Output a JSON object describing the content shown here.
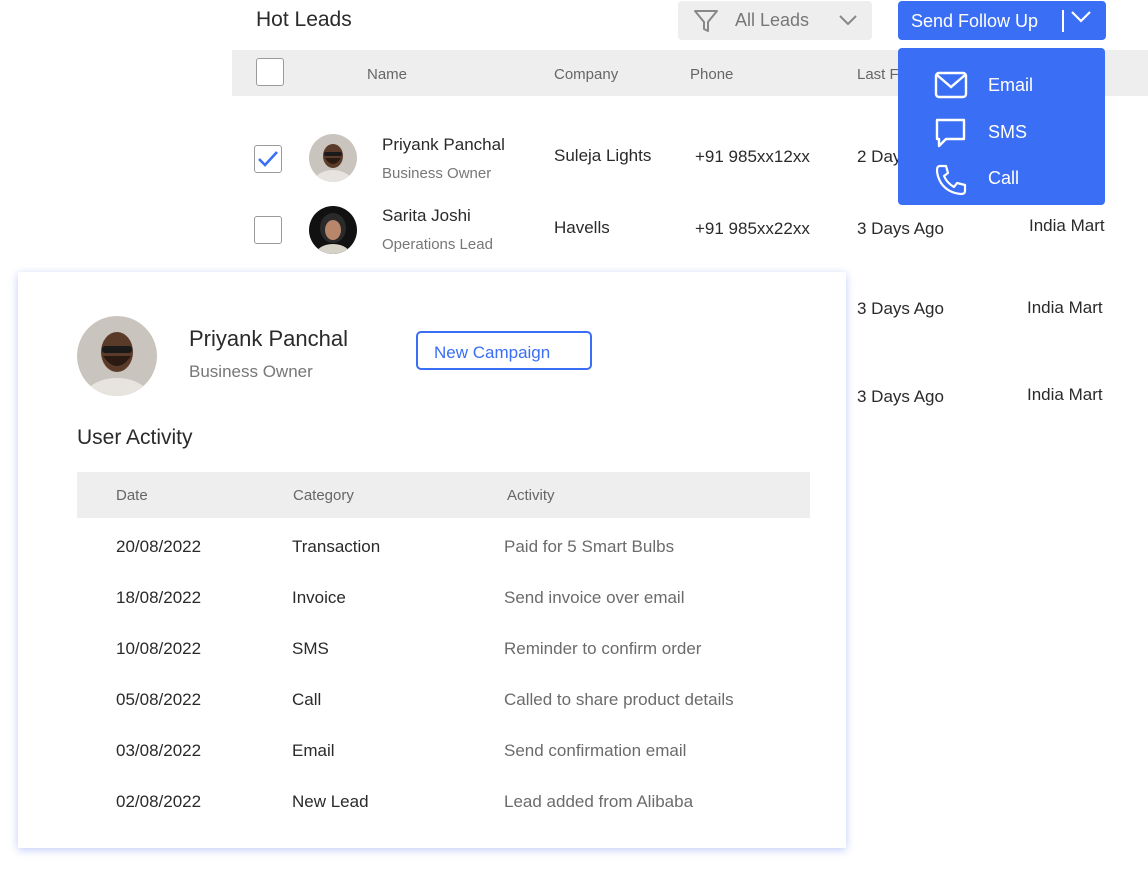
{
  "header": {
    "title": "Hot Leads",
    "filter_label": "All Leads",
    "send_button_label": "Send Follow Up"
  },
  "leads_table": {
    "columns": [
      "Name",
      "Company",
      "Phone",
      "Last F"
    ],
    "rows": [
      {
        "name": "Priyank Panchal",
        "role": "Business Owner",
        "company": "Suleja Lights",
        "phone": "+91 985xx12xx",
        "last": "2 Day",
        "source": "",
        "checked": true
      },
      {
        "name": "Sarita Joshi",
        "role": "Operations Lead",
        "company": "Havells",
        "phone": "+91 985xx22xx",
        "last": "3 Days Ago",
        "source": "India Mart",
        "checked": false
      }
    ],
    "hidden_rows": [
      {
        "last": "3 Days Ago",
        "source": "India Mart"
      },
      {
        "last": "3 Days Ago",
        "source": "India Mart"
      }
    ]
  },
  "dropdown": {
    "items": [
      {
        "label": "Email",
        "icon": "mail-icon"
      },
      {
        "label": "SMS",
        "icon": "chat-icon"
      },
      {
        "label": "Call",
        "icon": "phone-icon"
      }
    ]
  },
  "profile": {
    "name": "Priyank Panchal",
    "role": "Business Owner",
    "campaign_button": "New Campaign",
    "activity_title": "User Activity",
    "activity_columns": [
      "Date",
      "Category",
      "Activity"
    ],
    "activity": [
      {
        "date": "20/08/2022",
        "category": "Transaction",
        "activity": "Paid for 5 Smart Bulbs"
      },
      {
        "date": "18/08/2022",
        "category": "Invoice",
        "activity": "Send invoice over email"
      },
      {
        "date": "10/08/2022",
        "category": "SMS",
        "activity": "Reminder to confirm order"
      },
      {
        "date": "05/08/2022",
        "category": "Call",
        "activity": "Called to share product details"
      },
      {
        "date": "03/08/2022",
        "category": "Email",
        "activity": "Send confirmation email"
      },
      {
        "date": "02/08/2022",
        "category": "New Lead",
        "activity": "Lead added from Alibaba"
      }
    ]
  },
  "colors": {
    "accent": "#3a6ef5",
    "header_bg": "#eeeeee"
  }
}
